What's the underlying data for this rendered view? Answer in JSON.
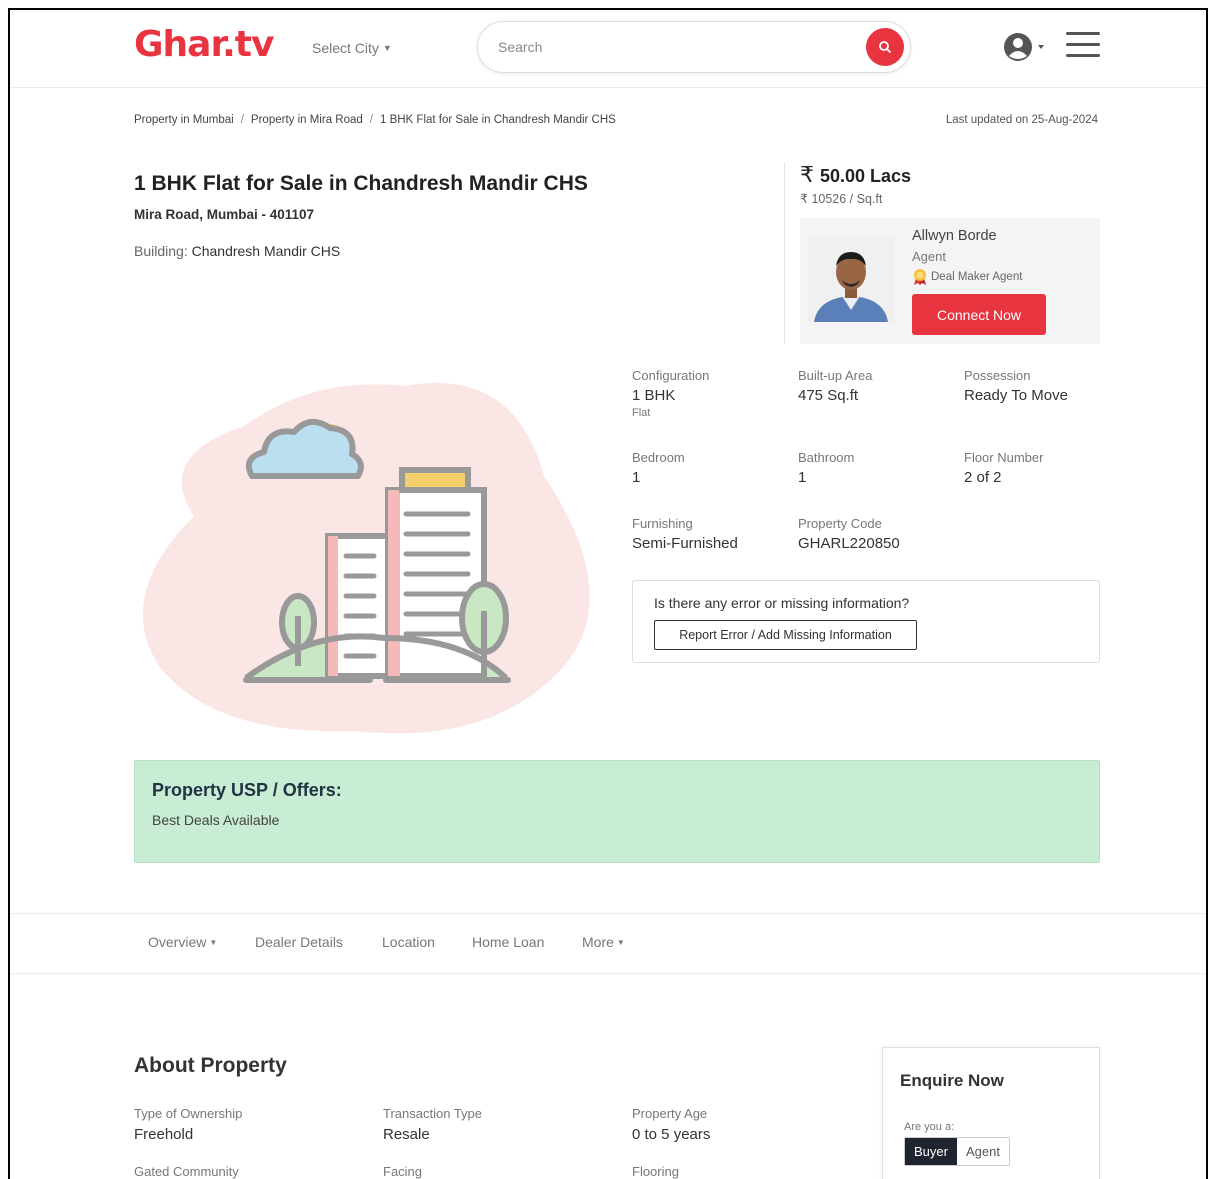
{
  "header": {
    "logo": "Ghar.tv",
    "city_label": "Select City",
    "search_placeholder": "Search"
  },
  "breadcrumb": {
    "items": [
      "Property in Mumbai",
      "Property in Mira Road",
      "1 BHK Flat for Sale in Chandresh Mandir CHS"
    ],
    "updated": "Last updated on 25-Aug-2024"
  },
  "listing": {
    "title": "1 BHK Flat for Sale in Chandresh Mandir CHS",
    "address": "Mira Road, Mumbai - 401107",
    "building_label": "Building:",
    "building_name": "Chandresh Mandir CHS",
    "price": "50.00 Lacs",
    "rate": "10526 / Sq.ft"
  },
  "agent": {
    "name": "Allwyn Borde",
    "role": "Agent",
    "badge": "Deal Maker Agent",
    "connect_label": "Connect Now"
  },
  "specs": [
    {
      "label": "Configuration",
      "value": "1 BHK",
      "sub": "Flat"
    },
    {
      "label": "Built-up Area",
      "value": "475 Sq.ft",
      "sub": ""
    },
    {
      "label": "Possession",
      "value": "Ready To Move",
      "sub": ""
    },
    {
      "label": "Bedroom",
      "value": "1",
      "sub": ""
    },
    {
      "label": "Bathroom",
      "value": "1",
      "sub": ""
    },
    {
      "label": "Floor Number",
      "value": "2 of 2",
      "sub": ""
    },
    {
      "label": "Furnishing",
      "value": "Semi-Furnished",
      "sub": ""
    },
    {
      "label": "Property Code",
      "value": "GHARL220850",
      "sub": ""
    }
  ],
  "error_box": {
    "question": "Is there any error or missing information?",
    "button": "Report Error / Add Missing Information"
  },
  "usp": {
    "heading": "Property USP / Offers:",
    "text": "Best Deals Available"
  },
  "tabs": [
    "Overview",
    "Dealer Details",
    "Location",
    "Home Loan",
    "More"
  ],
  "about": {
    "title": "About Property",
    "items": [
      {
        "label": "Type of Ownership",
        "value": "Freehold"
      },
      {
        "label": "Transaction Type",
        "value": "Resale"
      },
      {
        "label": "Property Age",
        "value": "0 to 5 years"
      },
      {
        "label": "Gated Community",
        "value": ""
      },
      {
        "label": "Facing",
        "value": ""
      },
      {
        "label": "Flooring",
        "value": ""
      }
    ]
  },
  "enquire": {
    "title": "Enquire Now",
    "question": "Are you a:",
    "options": [
      "Buyer",
      "Agent"
    ],
    "selected": "Buyer"
  },
  "colors": {
    "brand": "#e8343f",
    "usp_bg": "#c8ecd4",
    "toggle_active": "#1f2530"
  }
}
